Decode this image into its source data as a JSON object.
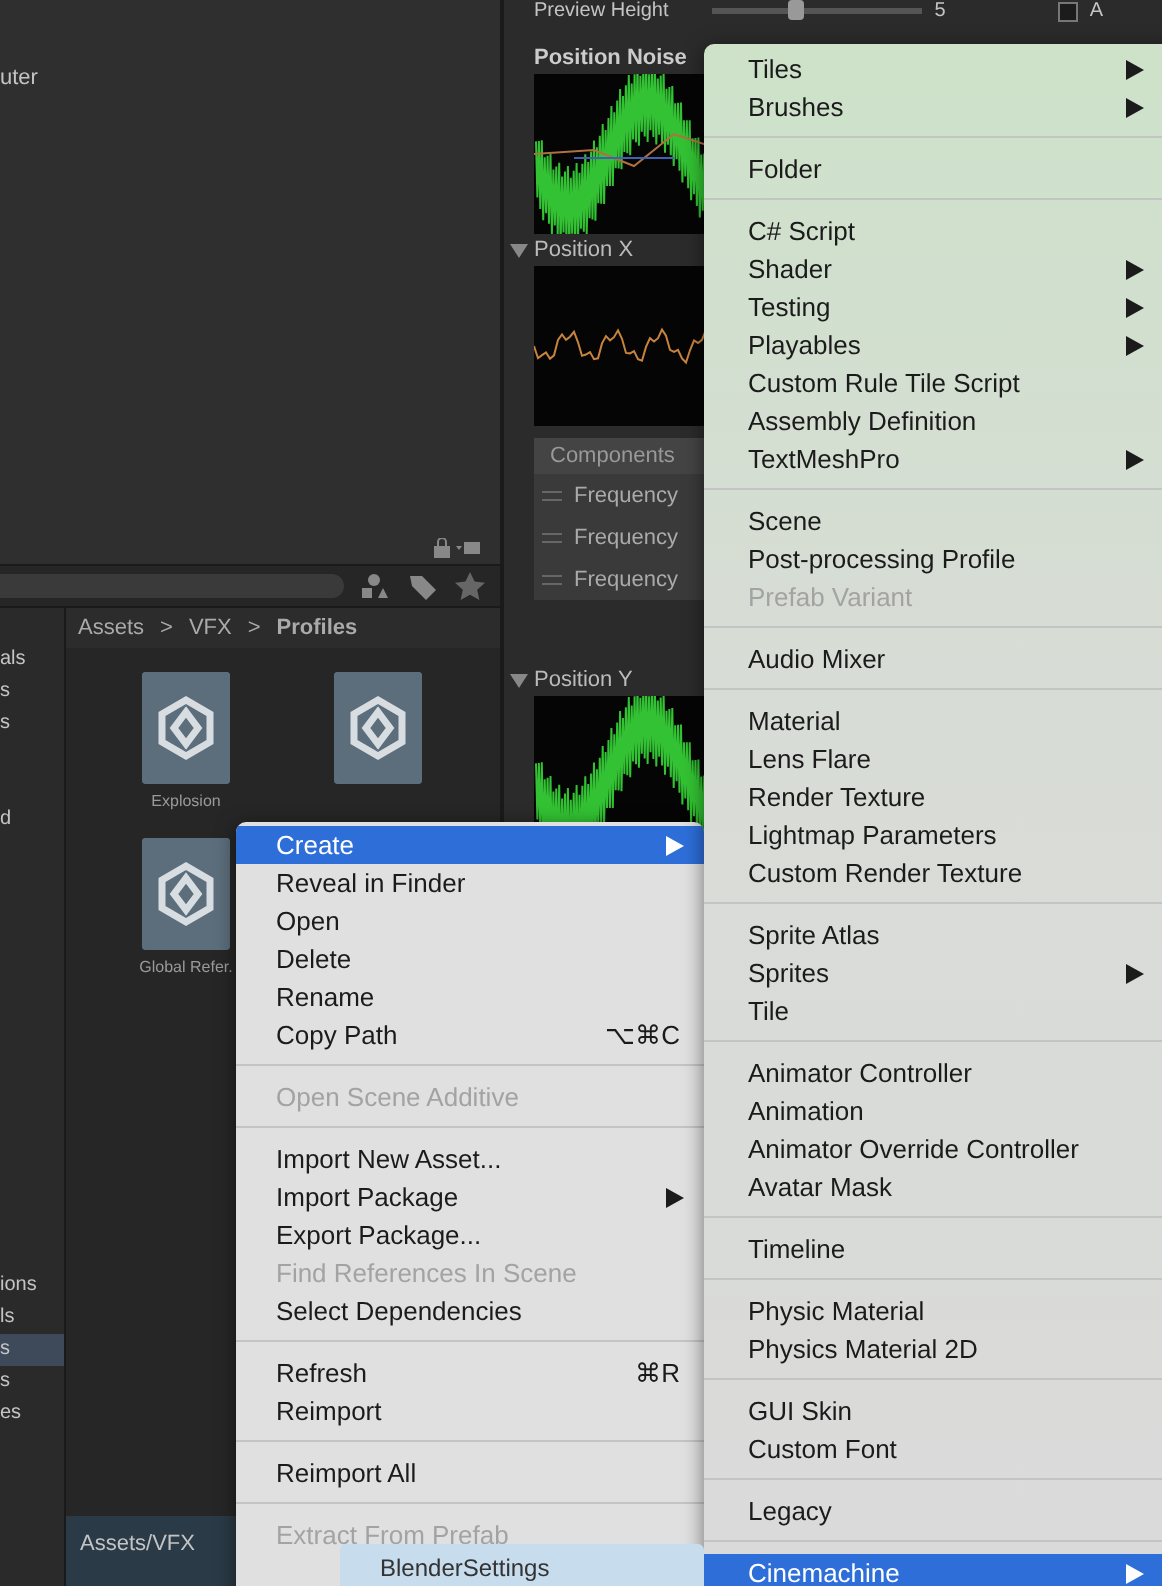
{
  "scene_panel": {
    "partial_label": "uter"
  },
  "inspector": {
    "preview_height": {
      "label": "Preview Height",
      "level": 0.4,
      "value": "5"
    },
    "toggle": {
      "label": "A",
      "checked": false
    },
    "position_noise": {
      "title": "Position Noise"
    },
    "position_x": {
      "title": "Position X",
      "expanded": true
    },
    "components": {
      "header": "Components",
      "rows": [
        {
          "label": "Frequency"
        },
        {
          "label": "Frequency"
        },
        {
          "label": "Frequency"
        }
      ]
    },
    "position_y": {
      "title": "Position Y",
      "expanded": true
    }
  },
  "project": {
    "sidebar_top": [
      {
        "label": "als"
      },
      {
        "label": "s"
      },
      {
        "label": "s"
      },
      {
        "label": "d"
      }
    ],
    "sidebar_bottom": [
      {
        "label": "ions",
        "selected": false
      },
      {
        "label": "ls",
        "selected": false
      },
      {
        "label": "s",
        "selected": true
      },
      {
        "label": "s",
        "selected": false
      },
      {
        "label": "es",
        "selected": false
      }
    ],
    "breadcrumb": [
      "Assets",
      ">",
      "VFX",
      ">",
      "Profiles"
    ],
    "assets": [
      {
        "kind": "asset",
        "label": "Explosion"
      },
      {
        "kind": "asset"
      },
      {
        "kind": "asset",
        "label": "Global Refer."
      }
    ],
    "status_bar": {
      "path": "Assets/VFX"
    }
  },
  "context_menu": {
    "items": [
      {
        "kind": "item",
        "label": "Create",
        "submenu": true,
        "disabled": false,
        "selected": true
      },
      {
        "kind": "item",
        "label": "Reveal in Finder",
        "submenu": false,
        "disabled": false,
        "selected": false
      },
      {
        "kind": "item",
        "label": "Open",
        "submenu": false,
        "disabled": false,
        "selected": false
      },
      {
        "kind": "item",
        "label": "Delete",
        "submenu": false,
        "disabled": false,
        "selected": false
      },
      {
        "kind": "item",
        "label": "Rename",
        "submenu": false,
        "disabled": false,
        "selected": false
      },
      {
        "kind": "item",
        "label": "Copy Path",
        "shortcut": "⌥⌘C",
        "submenu": false,
        "disabled": false,
        "selected": false
      },
      {
        "kind": "separator"
      },
      {
        "kind": "item",
        "label": "Open Scene Additive",
        "submenu": false,
        "disabled": true,
        "selected": false
      },
      {
        "kind": "separator"
      },
      {
        "kind": "item",
        "label": "Import New Asset...",
        "submenu": false,
        "disabled": false,
        "selected": false
      },
      {
        "kind": "item",
        "label": "Import Package",
        "submenu": true,
        "disabled": false,
        "selected": false
      },
      {
        "kind": "item",
        "label": "Export Package...",
        "submenu": false,
        "disabled": false,
        "selected": false
      },
      {
        "kind": "item",
        "label": "Find References In Scene",
        "submenu": false,
        "disabled": true,
        "selected": false
      },
      {
        "kind": "item",
        "label": "Select Dependencies",
        "submenu": false,
        "disabled": false,
        "selected": false
      },
      {
        "kind": "separator"
      },
      {
        "kind": "item",
        "label": "Refresh",
        "shortcut": "⌘R",
        "submenu": false,
        "disabled": false,
        "selected": false
      },
      {
        "kind": "item",
        "label": "Reimport",
        "submenu": false,
        "disabled": false,
        "selected": false
      },
      {
        "kind": "separator"
      },
      {
        "kind": "item",
        "label": "Reimport All",
        "submenu": false,
        "disabled": false,
        "selected": false
      },
      {
        "kind": "separator"
      },
      {
        "kind": "item",
        "label": "Extract From Prefab",
        "submenu": false,
        "disabled": true,
        "selected": false
      }
    ]
  },
  "create_submenu": {
    "items": [
      {
        "kind": "item",
        "label": "Tiles",
        "submenu": true,
        "disabled": false,
        "selected": false
      },
      {
        "kind": "item",
        "label": "Brushes",
        "submenu": true,
        "disabled": false,
        "selected": false
      },
      {
        "kind": "separator"
      },
      {
        "kind": "item",
        "label": "Folder",
        "submenu": false,
        "disabled": false,
        "selected": false
      },
      {
        "kind": "separator"
      },
      {
        "kind": "item",
        "label": "C# Script",
        "submenu": false,
        "disabled": false,
        "selected": false
      },
      {
        "kind": "item",
        "label": "Shader",
        "submenu": true,
        "disabled": false,
        "selected": false
      },
      {
        "kind": "item",
        "label": "Testing",
        "submenu": true,
        "disabled": false,
        "selected": false
      },
      {
        "kind": "item",
        "label": "Playables",
        "submenu": true,
        "disabled": false,
        "selected": false
      },
      {
        "kind": "item",
        "label": "Custom Rule Tile Script",
        "submenu": false,
        "disabled": false,
        "selected": false
      },
      {
        "kind": "item",
        "label": "Assembly Definition",
        "submenu": false,
        "disabled": false,
        "selected": false
      },
      {
        "kind": "item",
        "label": "TextMeshPro",
        "submenu": true,
        "disabled": false,
        "selected": false
      },
      {
        "kind": "separator"
      },
      {
        "kind": "item",
        "label": "Scene",
        "submenu": false,
        "disabled": false,
        "selected": false
      },
      {
        "kind": "item",
        "label": "Post-processing Profile",
        "submenu": false,
        "disabled": false,
        "selected": false
      },
      {
        "kind": "item",
        "label": "Prefab Variant",
        "submenu": false,
        "disabled": true,
        "selected": false
      },
      {
        "kind": "separator"
      },
      {
        "kind": "item",
        "label": "Audio Mixer",
        "submenu": false,
        "disabled": false,
        "selected": false
      },
      {
        "kind": "separator"
      },
      {
        "kind": "item",
        "label": "Material",
        "submenu": false,
        "disabled": false,
        "selected": false
      },
      {
        "kind": "item",
        "label": "Lens Flare",
        "submenu": false,
        "disabled": false,
        "selected": false
      },
      {
        "kind": "item",
        "label": "Render Texture",
        "submenu": false,
        "disabled": false,
        "selected": false
      },
      {
        "kind": "item",
        "label": "Lightmap Parameters",
        "submenu": false,
        "disabled": false,
        "selected": false
      },
      {
        "kind": "item",
        "label": "Custom Render Texture",
        "submenu": false,
        "disabled": false,
        "selected": false
      },
      {
        "kind": "separator"
      },
      {
        "kind": "item",
        "label": "Sprite Atlas",
        "submenu": false,
        "disabled": false,
        "selected": false
      },
      {
        "kind": "item",
        "label": "Sprites",
        "submenu": true,
        "disabled": false,
        "selected": false
      },
      {
        "kind": "item",
        "label": "Tile",
        "submenu": false,
        "disabled": false,
        "selected": false
      },
      {
        "kind": "separator"
      },
      {
        "kind": "item",
        "label": "Animator Controller",
        "submenu": false,
        "disabled": false,
        "selected": false
      },
      {
        "kind": "item",
        "label": "Animation",
        "submenu": false,
        "disabled": false,
        "selected": false
      },
      {
        "kind": "item",
        "label": "Animator Override Controller",
        "submenu": false,
        "disabled": false,
        "selected": false
      },
      {
        "kind": "item",
        "label": "Avatar Mask",
        "submenu": false,
        "disabled": false,
        "selected": false
      },
      {
        "kind": "separator"
      },
      {
        "kind": "item",
        "label": "Timeline",
        "submenu": false,
        "disabled": false,
        "selected": false
      },
      {
        "kind": "separator"
      },
      {
        "kind": "item",
        "label": "Physic Material",
        "submenu": false,
        "disabled": false,
        "selected": false
      },
      {
        "kind": "item",
        "label": "Physics Material 2D",
        "submenu": false,
        "disabled": false,
        "selected": false
      },
      {
        "kind": "separator"
      },
      {
        "kind": "item",
        "label": "GUI Skin",
        "submenu": false,
        "disabled": false,
        "selected": false
      },
      {
        "kind": "item",
        "label": "Custom Font",
        "submenu": false,
        "disabled": false,
        "selected": false
      },
      {
        "kind": "separator"
      },
      {
        "kind": "item",
        "label": "Legacy",
        "submenu": false,
        "disabled": false,
        "selected": false
      },
      {
        "kind": "separator"
      },
      {
        "kind": "item",
        "label": "Cinemachine",
        "submenu": true,
        "disabled": false,
        "selected": true
      }
    ]
  },
  "drag_label": {
    "text": "BlenderSettings"
  }
}
